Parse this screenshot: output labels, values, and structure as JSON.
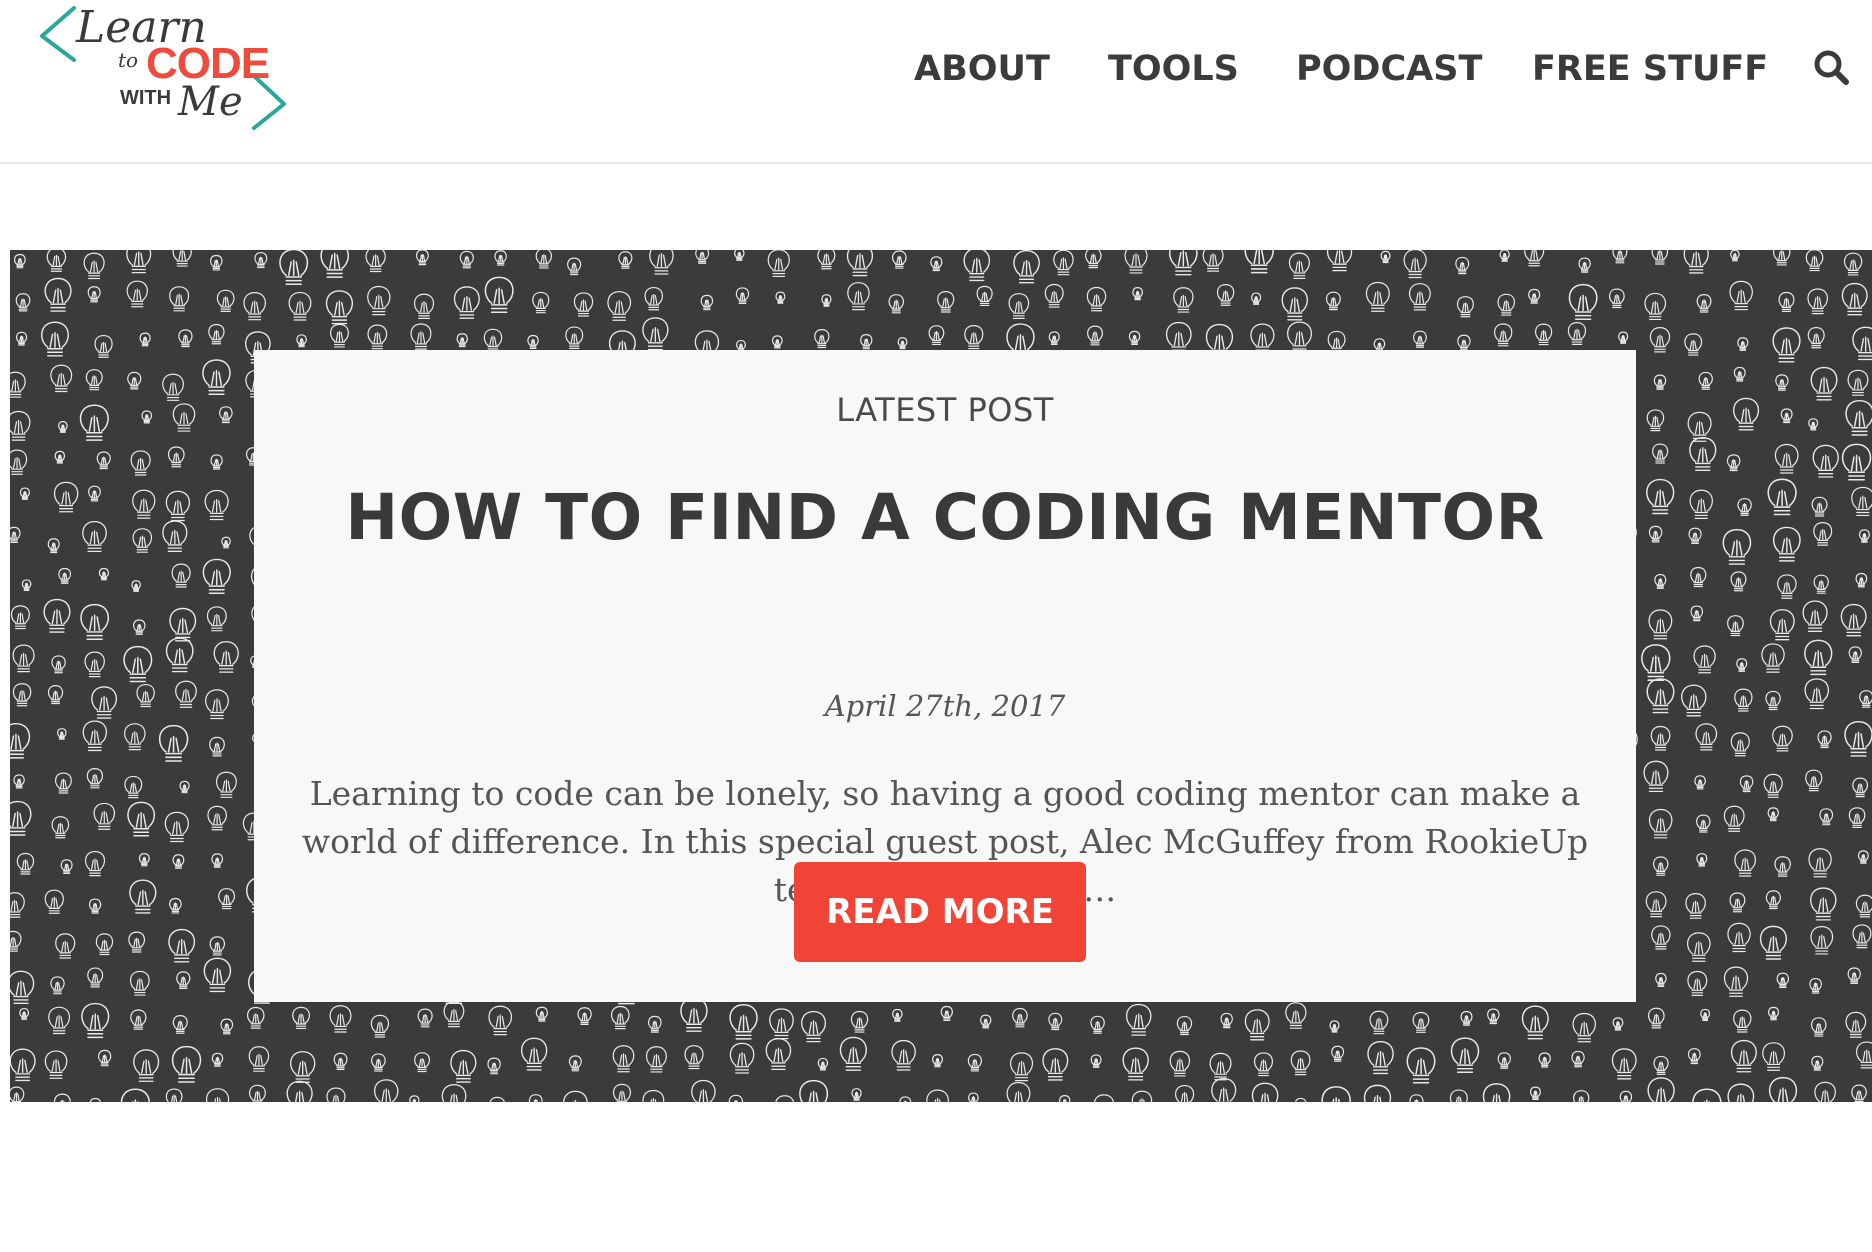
{
  "header": {
    "logo": {
      "learn": "Learn",
      "to": "to",
      "code": "CODE",
      "with": "WITH",
      "me": "Me"
    },
    "nav": [
      {
        "label": "ABOUT"
      },
      {
        "label": "TOOLS"
      },
      {
        "label": "PODCAST"
      },
      {
        "label": "FREE STUFF"
      }
    ],
    "search_icon": "search-icon"
  },
  "hero": {
    "background_pattern": "lightbulb-doodles",
    "card": {
      "label": "LATEST POST",
      "title": "HOW TO FIND A CODING MENTOR",
      "date": "April 27th, 2017",
      "excerpt": "Learning to code can be lonely, so having a good coding mentor can make a world of difference. In this special guest post, Alec McGuffey from RookieUp tells us everything…",
      "button_label": "READ MORE"
    }
  },
  "colors": {
    "accent_red": "#f24436",
    "logo_teal": "#2aa79b",
    "text_dark": "#3a3a3a",
    "hero_bg": "#3b3b3c",
    "card_bg": "#f8f8f8"
  }
}
